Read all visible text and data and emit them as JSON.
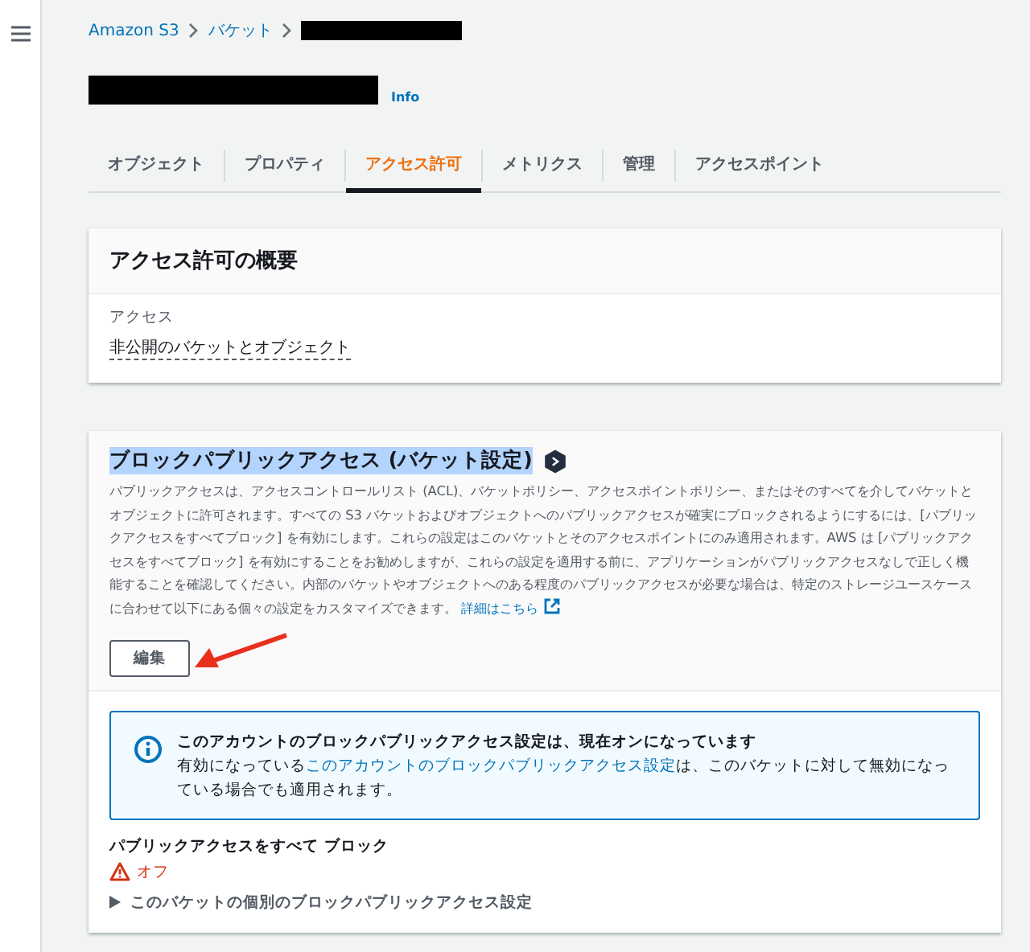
{
  "breadcrumb": [
    "Amazon S3",
    "バケット"
  ],
  "info_link": "Info",
  "tabs": [
    {
      "label": "オブジェクト",
      "selected": false
    },
    {
      "label": "プロパティ",
      "selected": false
    },
    {
      "label": "アクセス許可",
      "selected": true
    },
    {
      "label": "メトリクス",
      "selected": false
    },
    {
      "label": "管理",
      "selected": false
    },
    {
      "label": "アクセスポイント",
      "selected": false
    }
  ],
  "overview": {
    "title": "アクセス許可の概要",
    "label": "アクセス",
    "value": "非公開のバケットとオブジェクト"
  },
  "block_public_access": {
    "title": "ブロックパブリックアクセス (バケット設定)",
    "title_highlighted": true,
    "description": "パブリックアクセスは、アクセスコントロールリスト (ACL)、バケットポリシー、アクセスポイントポリシー、またはそのすべてを介してバケットとオブジェクトに許可されます。すべての S3 バケットおよびオブジェクトへのパブリックアクセスが確実にブロックされるようにするには、[パブリックアクセスをすべてブロック] を有効にします。これらの設定はこのバケットとそのアクセスポイントにのみ適用されます。AWS は [パブリックアクセスをすべてブロック] を有効にすることをお勧めしますが、これらの設定を適用する前に、アプリケーションがパブリックアクセスなしで正しく機能することを確認してください。内部のバケットやオブジェクトへのある程度のパブリックアクセスが必要な場合は、特定のストレージユースケースに合わせて以下にある個々の設定をカスタマイズできます。",
    "learn_more": "詳細はこちら",
    "edit_button": "編集",
    "alert": {
      "title": "このアカウントのブロックパブリックアクセス設定は、現在オンになっています",
      "text_before": "有効になっている",
      "link": "このアカウントのブロックパブリックアクセス設定",
      "text_after": "は、このバケットに対して無効になっている場合でも適用されます。"
    },
    "setting_label": "パブリックアクセスをすべて ブロック",
    "setting_status": {
      "text": "オフ",
      "on": false
    },
    "details": {
      "label": "このバケットの個別のブロックパブリックアクセス設定",
      "expanded": false
    }
  }
}
